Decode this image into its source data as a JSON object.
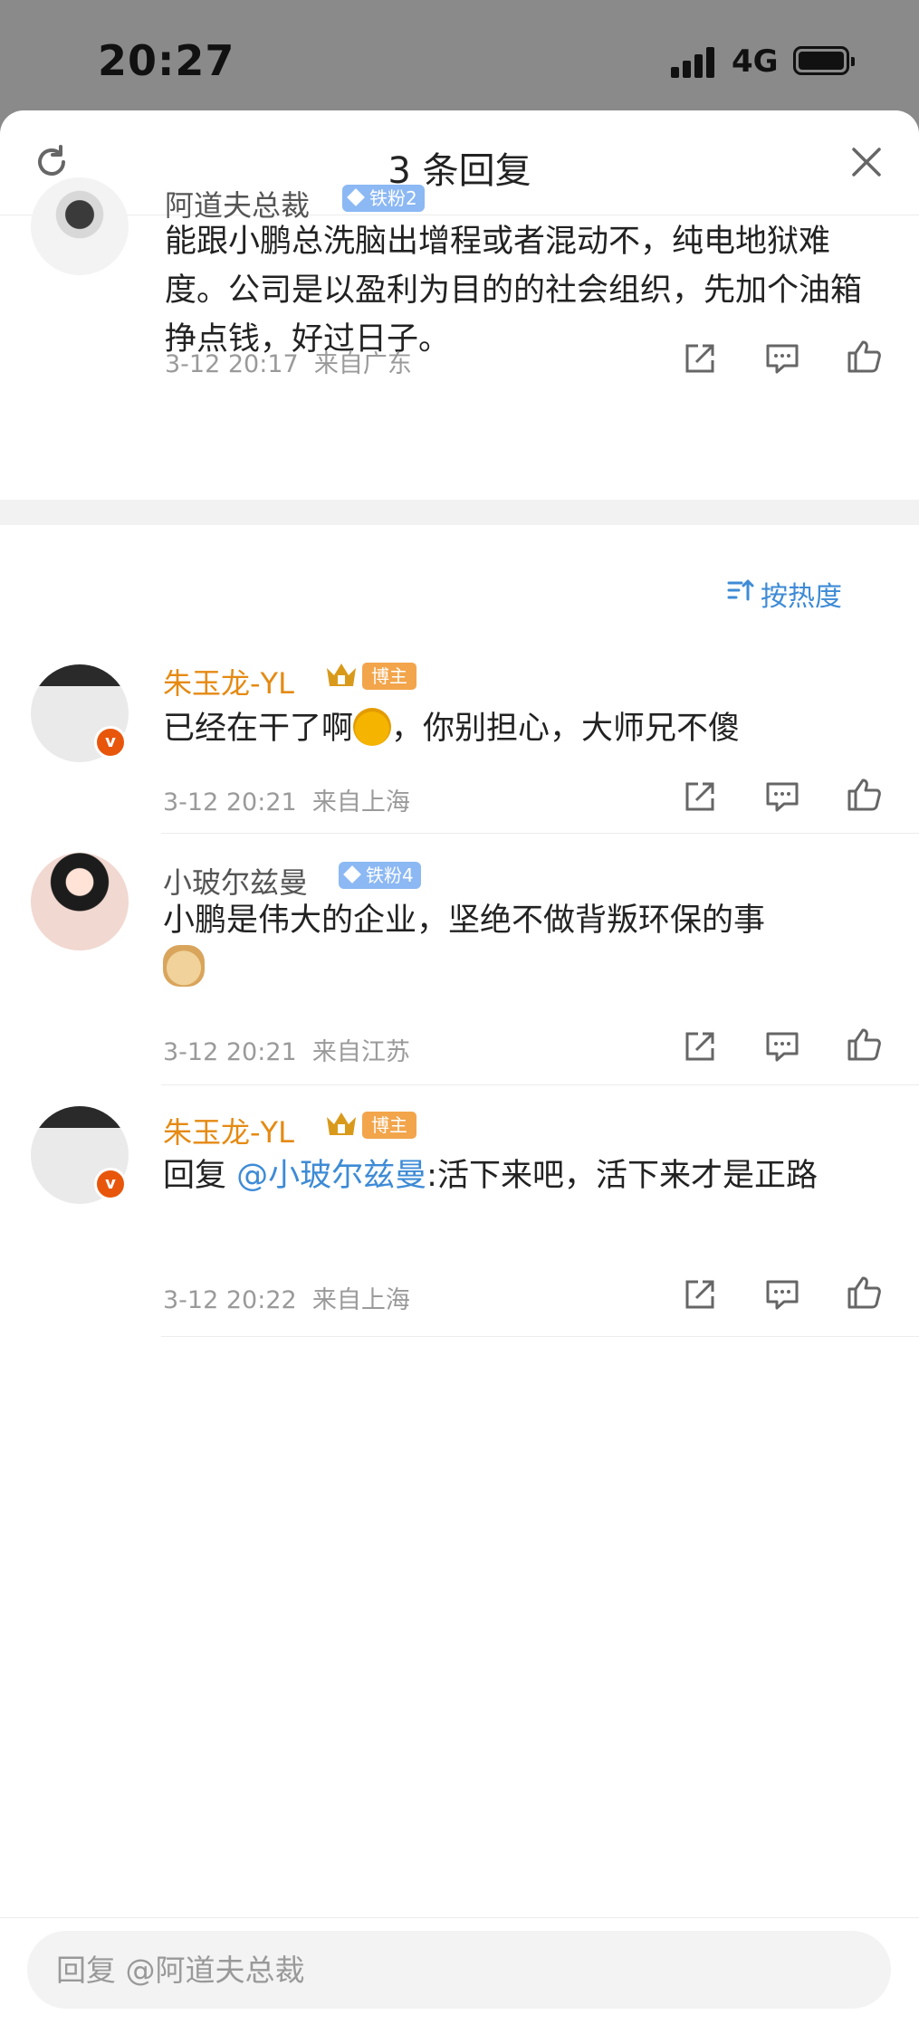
{
  "status_bar": {
    "time": "20:27",
    "network": "4G"
  },
  "sheet": {
    "title": "3 条回复"
  },
  "root_comment": {
    "author": "阿道夫总裁",
    "fan_badge": "铁粉2",
    "text": "能跟小鹏总洗脑出增程或者混动不，纯电地狱难度。公司是以盈利为目的的社会组织，先加个油箱挣点钱，好过日子。",
    "time": "3-12 20:17",
    "location": "来自广东"
  },
  "sort": {
    "label": "按热度"
  },
  "replies": [
    {
      "author": "朱玉龙-YL",
      "host_badge": "博主",
      "text_before": "已经在干了啊",
      "text_after": "，你别担心，大师兄不傻",
      "emoji": "laughing-emoji",
      "time": "3-12 20:21",
      "location": "来自上海"
    },
    {
      "author": "小玻尔兹曼",
      "fan_badge": "铁粉4",
      "text": "小鹏是伟大的企业，坚绝不做背叛环保的事",
      "emoji": "doge-emoji",
      "time": "3-12 20:21",
      "location": "来自江苏"
    },
    {
      "author": "朱玉龙-YL",
      "host_badge": "博主",
      "text_prefix": "回复 ",
      "mention": "@小玻尔兹曼",
      "text": ":活下来吧，活下来才是正路",
      "time": "3-12 20:22",
      "location": "来自上海"
    }
  ],
  "footer": {
    "placeholder": "回复 @阿道夫总裁"
  },
  "colors": {
    "accent": "#3e8bd6",
    "vip_name": "#e58a13",
    "verified": "#e8560c",
    "fan_badge": "#8cb8f4"
  }
}
